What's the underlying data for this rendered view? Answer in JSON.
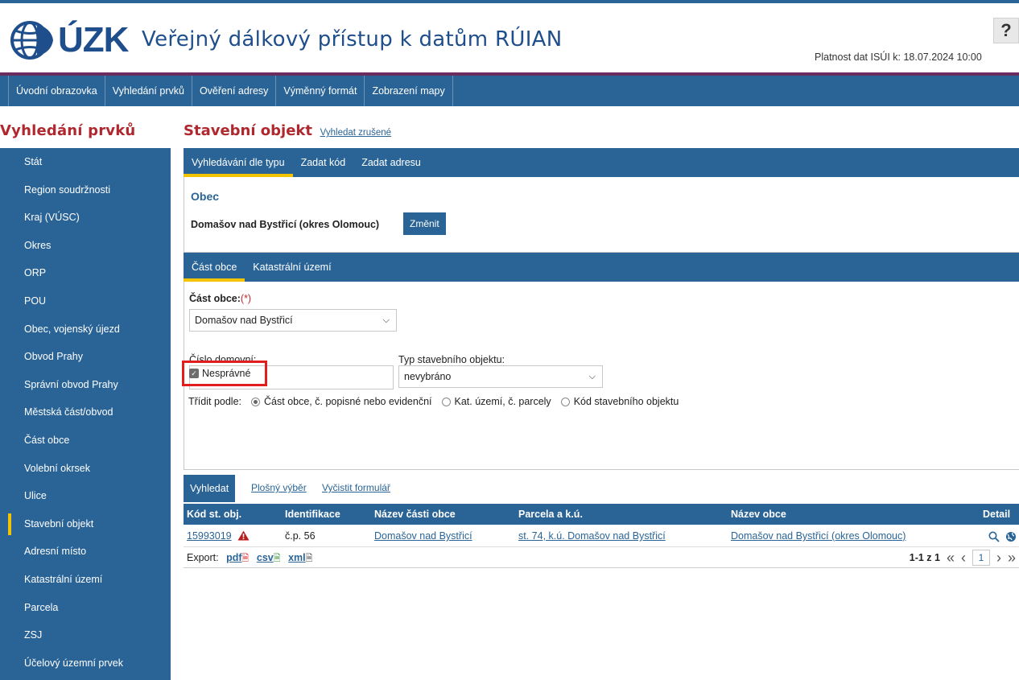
{
  "header": {
    "logo_text": "ÚZK",
    "app_title": "Veřejný dálkový přístup k datům RÚIAN",
    "help_label": "?",
    "validity_text": "Platnost dat ISÚI k: 18.07.2024 10:00"
  },
  "main_nav": [
    "Úvodní obrazovka",
    "Vyhledání prvků",
    "Ověření adresy",
    "Výměnný formát",
    "Zobrazení mapy"
  ],
  "sidebar": {
    "title": "Vyhledání prvků",
    "items": [
      "Stát",
      "Region soudržnosti",
      "Kraj (VÚSC)",
      "Okres",
      "ORP",
      "POU",
      "Obec, vojenský újezd",
      "Obvod Prahy",
      "Správní obvod Prahy",
      "Městská část/obvod",
      "Část obce",
      "Volební okrsek",
      "Ulice",
      "Stavební objekt",
      "Adresní místo",
      "Katastrální území",
      "Parcela",
      "ZSJ",
      "Účelový územní prvek"
    ],
    "active": "Stavební objekt"
  },
  "page": {
    "heading": "Stavební objekt",
    "heading_link": "Vyhledat zrušené"
  },
  "tabs1": [
    "Vyhledávání dle typu",
    "Zadat kód",
    "Zadat adresu"
  ],
  "obec": {
    "label": "Obec",
    "value": "Domašov nad Bystřicí (okres Olomouc)",
    "change_button": "Změnit"
  },
  "tabs2": [
    "Část obce",
    "Katastrální území"
  ],
  "form": {
    "cast_obce_label": "Část obce:",
    "required_mark": "(*)",
    "cast_obce_value": "Domašov nad Bystřicí",
    "cislo_label": "Číslo domovní:",
    "cislo_value": "",
    "typ_label": "Typ stavebního objektu:",
    "typ_value": "nevybráno",
    "checkbox_label": "Nesprávné",
    "checkbox_checked": true,
    "sort_label": "Třídit podle:",
    "sort_options": [
      "Část obce, č. popisné nebo evidenční",
      "Kat. území, č. parcely",
      "Kód stavebního objektu"
    ],
    "sort_selected": 0
  },
  "actions": {
    "search_button": "Vyhledat",
    "area_select": "Plošný výběr",
    "clear_form": "Vyčistit formulář"
  },
  "table": {
    "columns": [
      "Kód st. obj.",
      "Identifikace",
      "Název části obce",
      "Parcela a k.ú.",
      "Název obce",
      "Detail"
    ],
    "rows": [
      {
        "kod": "15993019",
        "identifikace": "č.p. 56",
        "cast_obce": "Domašov nad Bystřicí",
        "parcela": "st. 74, k.ú. Domašov nad Bystřicí",
        "obec": "Domašov nad Bystřicí (okres Olomouc)"
      }
    ]
  },
  "export": {
    "label": "Export:",
    "formats": [
      "pdf",
      "csv",
      "xml"
    ]
  },
  "pager": {
    "range_text": "1-1 z 1",
    "current_page": "1"
  },
  "colors": {
    "brand_blue": "#2a6496",
    "title_red": "#b0282e",
    "active_yellow": "#f2c300",
    "highlight_red": "#e21d1d"
  }
}
